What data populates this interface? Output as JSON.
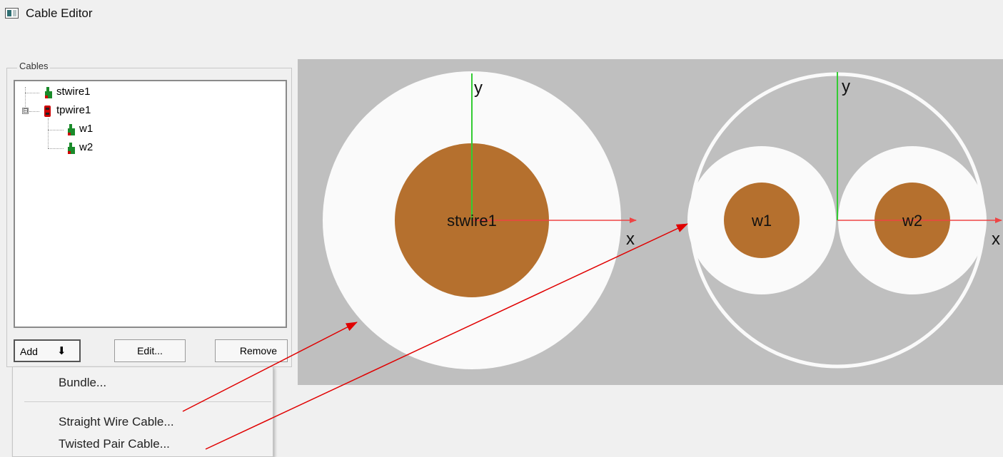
{
  "window": {
    "title": "Cable Editor",
    "icon": "app-window-icon"
  },
  "cables_panel": {
    "group_label": "Cables",
    "tree": [
      {
        "label": "stwire1",
        "icon": "straight-wire-icon"
      },
      {
        "label": "tpwire1",
        "icon": "twisted-pair-icon",
        "expanded": true,
        "expander": "⊟"
      },
      {
        "label": "w1",
        "icon": "straight-wire-icon"
      },
      {
        "label": "w2",
        "icon": "straight-wire-icon"
      }
    ],
    "buttons": {
      "add": "Add",
      "add_arrow": "⬇",
      "edit": "Edit...",
      "remove": "Remove"
    }
  },
  "add_menu": {
    "items": [
      {
        "label": "Bundle..."
      },
      {
        "label": "Straight Wire Cable..."
      },
      {
        "label": "Twisted Pair Cable..."
      }
    ]
  },
  "canvas": {
    "cable1": {
      "name": "stwire1",
      "axis_x": "x",
      "axis_y": "y"
    },
    "cable2": {
      "wires": [
        "w1",
        "w2"
      ],
      "axis_x": "x",
      "axis_y": "y"
    }
  },
  "colors": {
    "canvas_bg": "#bfbfbf",
    "insulation": "#fafafa",
    "conductor": "#b5702e",
    "y_axis": "#33cc33",
    "x_axis": "#ee4444",
    "annotation_arrow": "#e00000",
    "wire_icon": "#1a8a2a",
    "pair_icon": "#cc0000"
  }
}
